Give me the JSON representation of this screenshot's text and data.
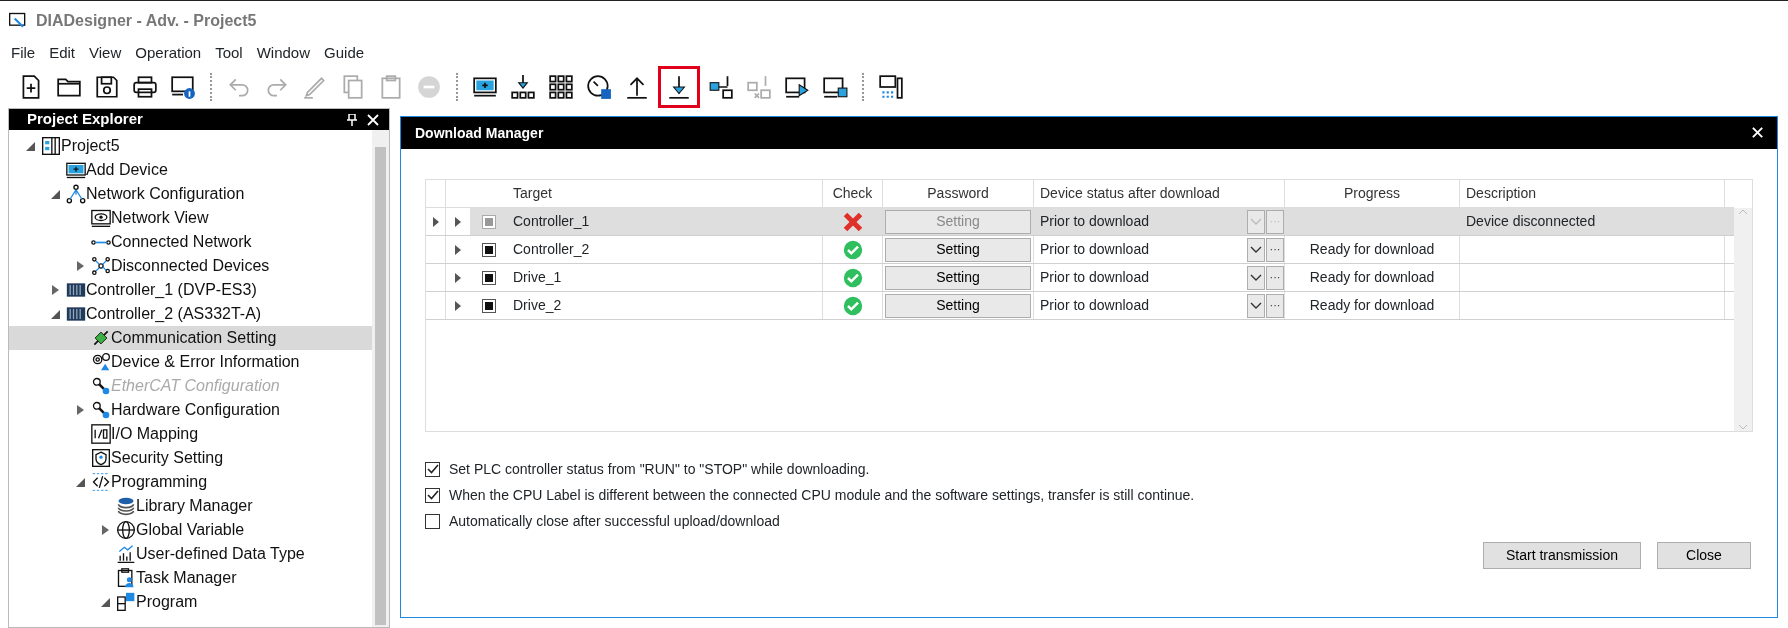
{
  "window": {
    "title": "DIADesigner - Adv. - Project5"
  },
  "menu": [
    "File",
    "Edit",
    "View",
    "Operation",
    "Tool",
    "Window",
    "Guide"
  ],
  "toolbar": [
    {
      "kind": "new",
      "disabled": false,
      "highlighted": false
    },
    {
      "kind": "open",
      "disabled": false,
      "highlighted": false
    },
    {
      "kind": "save",
      "disabled": false,
      "highlighted": false
    },
    {
      "kind": "print",
      "disabled": false,
      "highlighted": false
    },
    {
      "kind": "info",
      "disabled": false,
      "highlighted": false
    },
    {
      "kind": "sep"
    },
    {
      "kind": "undo",
      "disabled": true,
      "highlighted": false
    },
    {
      "kind": "redo",
      "disabled": true,
      "highlighted": false
    },
    {
      "kind": "pencil",
      "disabled": true,
      "highlighted": false
    },
    {
      "kind": "copy",
      "disabled": true,
      "highlighted": false
    },
    {
      "kind": "paste",
      "disabled": true,
      "highlighted": false
    },
    {
      "kind": "stop",
      "disabled": true,
      "highlighted": false
    },
    {
      "kind": "sep"
    },
    {
      "kind": "monitor",
      "disabled": false,
      "highlighted": false
    },
    {
      "kind": "distribute",
      "disabled": false,
      "highlighted": false
    },
    {
      "kind": "grid",
      "disabled": false,
      "highlighted": false
    },
    {
      "kind": "gauge",
      "disabled": false,
      "highlighted": false
    },
    {
      "kind": "upload",
      "disabled": false,
      "highlighted": false
    },
    {
      "kind": "download",
      "disabled": false,
      "highlighted": true
    },
    {
      "kind": "connect",
      "disabled": false,
      "highlighted": false
    },
    {
      "kind": "disconnect",
      "disabled": true,
      "highlighted": false
    },
    {
      "kind": "run",
      "disabled": false,
      "highlighted": false
    },
    {
      "kind": "halt",
      "disabled": false,
      "highlighted": false
    },
    {
      "kind": "sep"
    },
    {
      "kind": "device",
      "disabled": false,
      "highlighted": false
    }
  ],
  "explorer": {
    "title": "Project Explorer",
    "tree": [
      {
        "label": "Project5",
        "kind": "project",
        "expanded": true,
        "selected": false,
        "disabled": false,
        "children": [
          {
            "label": "Add Device",
            "kind": "add",
            "selected": false,
            "disabled": false
          },
          {
            "label": "Network Configuration",
            "kind": "network",
            "expanded": true,
            "selected": false,
            "disabled": false,
            "children": [
              {
                "label": "Network View",
                "kind": "eye",
                "selected": false,
                "disabled": false
              },
              {
                "label": "Connected Network",
                "kind": "line",
                "selected": false,
                "disabled": false
              },
              {
                "label": "Disconnected Devices",
                "kind": "nodes",
                "expanded": false,
                "selected": false,
                "disabled": false
              }
            ]
          },
          {
            "label": "Controller_1 (DVP-ES3)",
            "kind": "plc",
            "expanded": false,
            "selected": false,
            "disabled": false
          },
          {
            "label": "Controller_2 (AS332T-A)",
            "kind": "plc",
            "expanded": true,
            "selected": false,
            "disabled": false,
            "children": [
              {
                "label": "Communication Setting",
                "kind": "plug",
                "selected": true,
                "disabled": false
              },
              {
                "label": "Device & Error Information",
                "kind": "gears",
                "selected": false,
                "disabled": false
              },
              {
                "label": "EtherCAT Configuration",
                "kind": "wrench",
                "selected": false,
                "disabled": true
              },
              {
                "label": "Hardware Configuration",
                "kind": "wrench",
                "expanded": false,
                "selected": false,
                "disabled": false
              },
              {
                "label": "I/O Mapping",
                "kind": "io",
                "selected": false,
                "disabled": false
              },
              {
                "label": "Security Setting",
                "kind": "shield",
                "selected": false,
                "disabled": false
              },
              {
                "label": "Programming",
                "kind": "code",
                "expanded": true,
                "selected": false,
                "disabled": false,
                "children": [
                  {
                    "label": "Library Manager",
                    "kind": "stack",
                    "selected": false,
                    "disabled": false
                  },
                  {
                    "label": "Global Variable",
                    "kind": "globe",
                    "expanded": false,
                    "selected": false,
                    "disabled": false
                  },
                  {
                    "label": "User-defined Data Type",
                    "kind": "chart",
                    "selected": false,
                    "disabled": false
                  },
                  {
                    "label": "Task Manager",
                    "kind": "clipboard",
                    "selected": false,
                    "disabled": false
                  },
                  {
                    "label": "Program",
                    "kind": "program",
                    "expanded": true,
                    "selected": false,
                    "disabled": false
                  }
                ]
              }
            ]
          }
        ]
      }
    ]
  },
  "dialog": {
    "title": "Download Manager",
    "close": "✕",
    "table": {
      "columns": [
        "Target",
        "Check",
        "Password",
        "Device status after download",
        "Progress",
        "Description"
      ],
      "rows": [
        {
          "selected": true,
          "disabled": true,
          "checked": true,
          "target": "Controller_1",
          "kind": "error",
          "password": "Setting",
          "status": "Prior to download",
          "more": "···",
          "progress": "",
          "description": "Device disconnected"
        },
        {
          "selected": false,
          "disabled": false,
          "checked": true,
          "target": "Controller_2",
          "kind": "ok",
          "password": "Setting",
          "status": "Prior to download",
          "more": "···",
          "progress": "Ready for download",
          "description": ""
        },
        {
          "selected": false,
          "disabled": false,
          "checked": true,
          "target": "Drive_1",
          "kind": "ok",
          "password": "Setting",
          "status": "Prior to download",
          "more": "···",
          "progress": "Ready for download",
          "description": ""
        },
        {
          "selected": false,
          "disabled": false,
          "checked": true,
          "target": "Drive_2",
          "kind": "ok",
          "password": "Setting",
          "status": "Prior to download",
          "more": "···",
          "progress": "Ready for download",
          "description": ""
        }
      ]
    },
    "options": [
      {
        "label": "Set PLC controller status from \"RUN\" to \"STOP\" while downloading.",
        "checked": true
      },
      {
        "label": "When the CPU Label is different between the connected CPU module and the software settings, transfer is still continue.",
        "checked": true
      },
      {
        "label": "Automatically close after successful upload/download",
        "checked": false
      }
    ],
    "buttons": [
      "Start transmission",
      "Close"
    ]
  }
}
